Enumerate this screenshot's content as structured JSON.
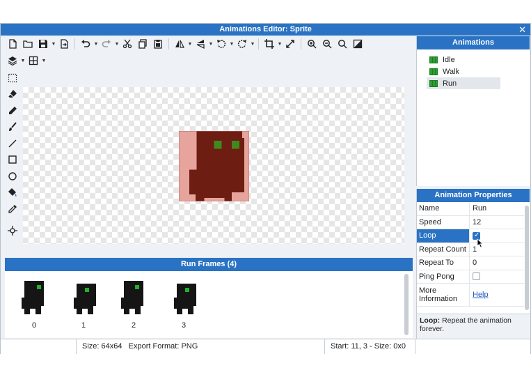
{
  "window": {
    "title": "Animations Editor: Sprite",
    "close_glyph": "✕"
  },
  "toolbar": {
    "icons": [
      "new-file-icon",
      "open-folder-icon",
      "save-icon",
      "export-icon",
      "undo-icon",
      "redo-icon",
      "cut-icon",
      "copy-icon",
      "paste-icon",
      "flip-horizontal-icon",
      "flip-vertical-icon",
      "rotate-left-icon",
      "rotate-right-icon",
      "crop-icon",
      "resize-icon",
      "zoom-in-icon",
      "zoom-out-icon",
      "zoom-fit-icon",
      "contrast-icon",
      "layers-icon",
      "grid-icon"
    ]
  },
  "tools": [
    "select-tool",
    "eraser-tool",
    "pencil-tool",
    "brush-tool",
    "line-tool",
    "rectangle-tool",
    "ellipse-tool",
    "fill-tool",
    "eyedropper-tool",
    "pivot-tool"
  ],
  "frames": {
    "header": "Run Frames (4)",
    "items": [
      {
        "label": "0"
      },
      {
        "label": "1"
      },
      {
        "label": "2"
      },
      {
        "label": "3"
      }
    ]
  },
  "status": {
    "size": "Size: 64x64",
    "format": "Export Format: PNG",
    "selection": "Start: 11, 3 - Size: 0x0"
  },
  "animations": {
    "header": "Animations",
    "items": [
      {
        "label": "Idle",
        "selected": false
      },
      {
        "label": "Walk",
        "selected": false
      },
      {
        "label": "Run",
        "selected": true
      }
    ]
  },
  "properties": {
    "header": "Animation Properties",
    "rows": {
      "name": {
        "label": "Name",
        "value": "Run"
      },
      "speed": {
        "label": "Speed",
        "value": "12"
      },
      "loop": {
        "label": "Loop",
        "checked": true
      },
      "repeat_count": {
        "label": "Repeat Count",
        "value": "1"
      },
      "repeat_to": {
        "label": "Repeat To",
        "value": "0"
      },
      "ping_pong": {
        "label": "Ping Pong",
        "checked": false
      },
      "more_info": {
        "label": "More Information",
        "link": "Help"
      }
    },
    "description_title": "Loop:",
    "description_text": "Repeat the animation forever."
  },
  "colors": {
    "accent": "#2a73c4",
    "sprite_body": "#6e1d12",
    "sprite_bg": "#e7a49c",
    "sprite_eye": "#3f8a1c",
    "frame_body": "#151515",
    "frame_eye": "#1fb12a"
  }
}
